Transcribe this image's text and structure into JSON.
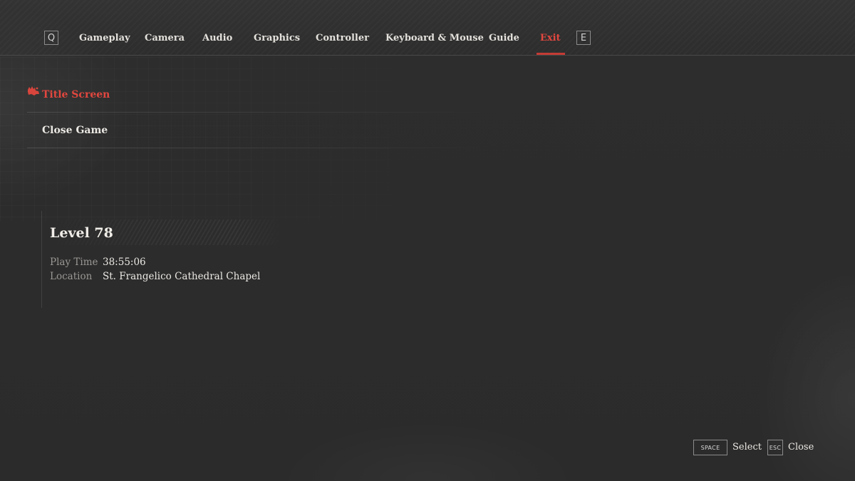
{
  "colors": {
    "accent": "#e2473f",
    "background": "#2b2b2b",
    "text": "#ece9e4",
    "muted": "#9a9794"
  },
  "nav": {
    "prev_key": "Q",
    "next_key": "E",
    "tabs": [
      {
        "label": "Gameplay",
        "active": false
      },
      {
        "label": "Camera",
        "active": false
      },
      {
        "label": "Audio",
        "active": false
      },
      {
        "label": "Graphics",
        "active": false
      },
      {
        "label": "Controller",
        "active": false
      },
      {
        "label": "Keyboard & Mouse",
        "active": false
      },
      {
        "label": "Guide",
        "active": false
      },
      {
        "label": "Exit",
        "active": true
      }
    ]
  },
  "menu": {
    "items": [
      {
        "label": "Title Screen",
        "selected": true,
        "icon": "selection-marker-icon"
      },
      {
        "label": "Close Game",
        "selected": false
      }
    ]
  },
  "save_info": {
    "level": "Level 78",
    "play_time_label": "Play Time",
    "play_time": "38:55:06",
    "location_label": "Location",
    "location": "St. Frangelico Cathedral Chapel"
  },
  "hints": [
    {
      "key": "SPACE",
      "label": "Select"
    },
    {
      "key": "ESC",
      "label": "Close"
    }
  ]
}
